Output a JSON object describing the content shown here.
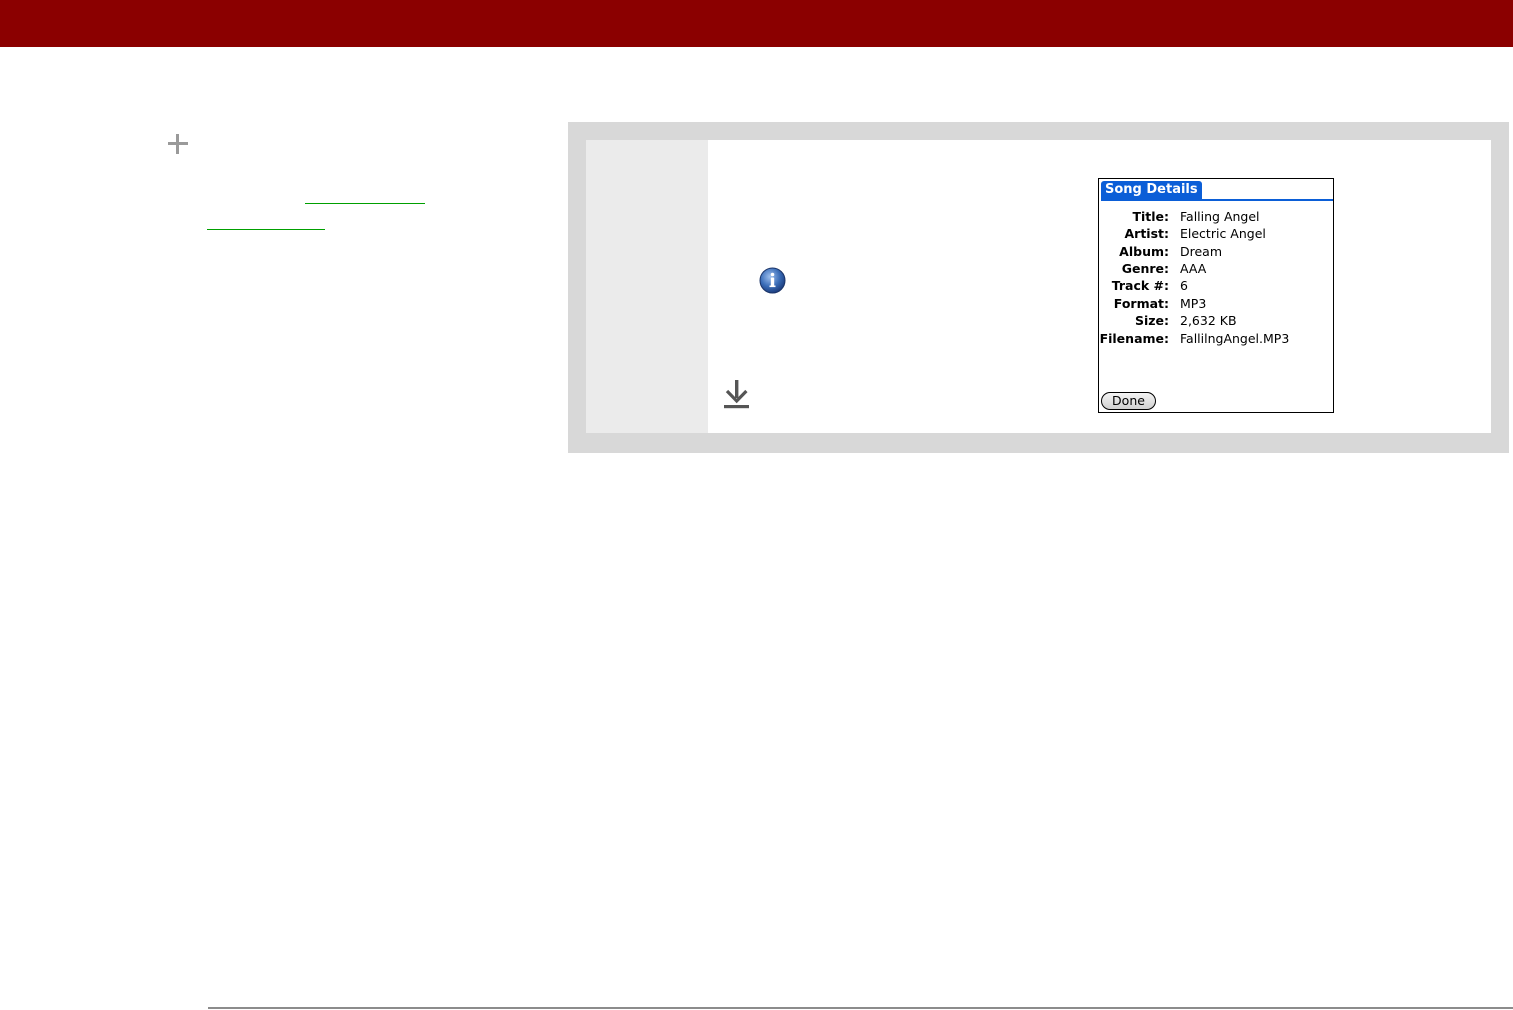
{
  "colors": {
    "header_bar": "#8b0000",
    "link_underline": "#00a000",
    "palm_accent": "#0b5ed7"
  },
  "sidebar": {
    "icon": "plus-icon",
    "links": [
      "",
      ""
    ]
  },
  "step": {
    "icons": [
      "info-icon",
      "download-arrow-icon"
    ]
  },
  "song_details": {
    "title": "Song Details",
    "fields": [
      {
        "label": "Title:",
        "value": "Falling Angel"
      },
      {
        "label": "Artist:",
        "value": "Electric Angel"
      },
      {
        "label": "Album:",
        "value": "Dream"
      },
      {
        "label": "Genre:",
        "value": "AAA"
      },
      {
        "label": "Track #:",
        "value": "6"
      },
      {
        "label": "Format:",
        "value": "MP3"
      },
      {
        "label": "Size:",
        "value": "2,632 KB"
      },
      {
        "label": "Filename:",
        "value": "FallilngAngel.MP3"
      }
    ],
    "done_label": "Done"
  }
}
